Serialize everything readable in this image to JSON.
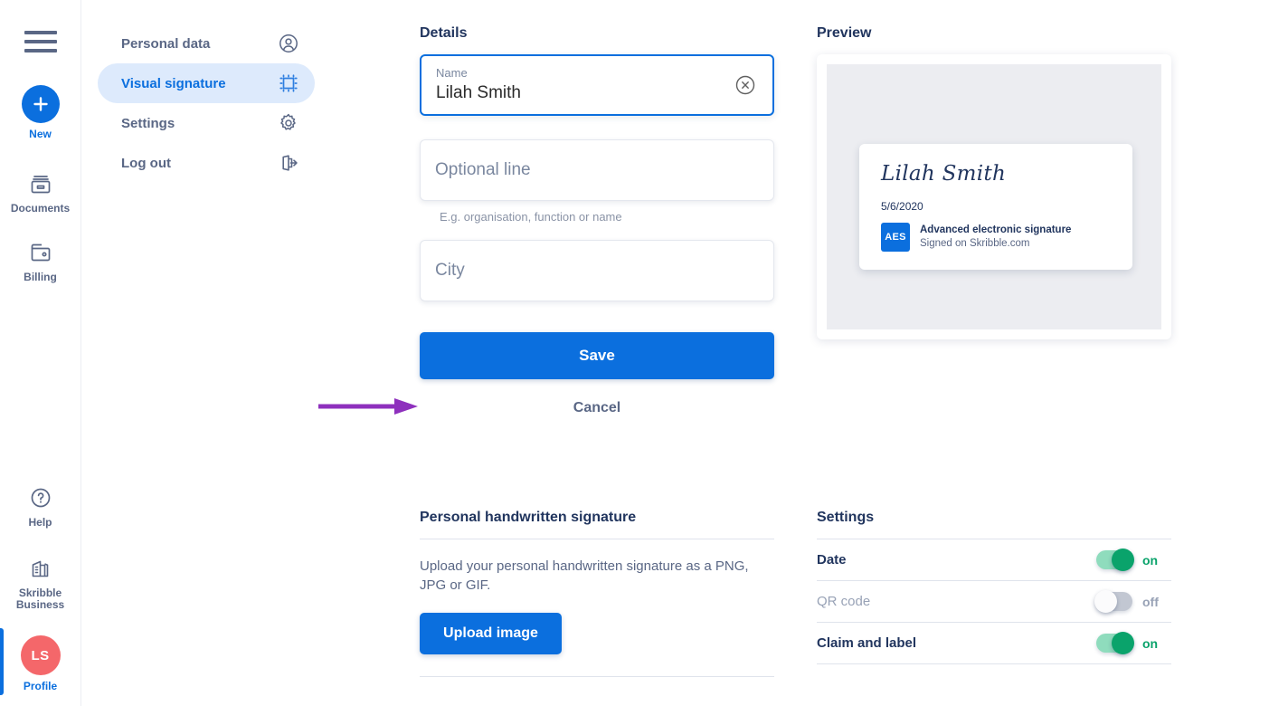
{
  "rail": {
    "menu_icon": "hamburger-icon",
    "items": [
      {
        "label": "New",
        "icon": "plus-icon",
        "active": false
      },
      {
        "label": "Documents",
        "icon": "documents-icon",
        "active": false
      },
      {
        "label": "Billing",
        "icon": "billing-icon",
        "active": false
      },
      {
        "label": "Help",
        "icon": "help-circle-icon",
        "active": false
      },
      {
        "label": "Skribble\nBusiness",
        "icon": "building-icon",
        "active": false
      },
      {
        "label": "Profile",
        "icon": "avatar-icon",
        "active": true
      }
    ],
    "help_label": "Help",
    "business_label_line1": "Skribble",
    "business_label_line2": "Business",
    "profile_label": "Profile",
    "new_label": "New",
    "documents_label": "Documents",
    "billing_label": "Billing",
    "avatar_initials": "LS"
  },
  "subnav": {
    "items": [
      {
        "label": "Personal data",
        "icon": "user-circle-icon",
        "active": false
      },
      {
        "label": "Visual signature",
        "icon": "crop-frame-icon",
        "active": true
      },
      {
        "label": "Settings",
        "icon": "gear-icon",
        "active": false
      },
      {
        "label": "Log out",
        "icon": "logout-icon",
        "active": false
      }
    ]
  },
  "details": {
    "title": "Details",
    "name_field": {
      "label": "Name",
      "value": "Lilah Smith",
      "clear_icon": "clear-circle-icon"
    },
    "optional_field": {
      "placeholder": "Optional line",
      "value": "",
      "hint": "E.g. organisation, function or name"
    },
    "city_field": {
      "placeholder": "City",
      "value": ""
    },
    "save_label": "Save",
    "cancel_label": "Cancel"
  },
  "annotation": {
    "arrow": "purple-arrow-pointing-to-save",
    "color": "#8e30bd"
  },
  "preview": {
    "title": "Preview",
    "signature": {
      "name": "Lilah Smith",
      "date": "5/6/2020",
      "badge": "AES",
      "claim": "Advanced electronic signature",
      "label": "Signed on Skribble.com"
    }
  },
  "handwritten": {
    "title": "Personal handwritten signature",
    "description": "Upload your personal handwritten signature as a PNG, JPG or GIF.",
    "upload_label": "Upload image"
  },
  "settings": {
    "title": "Settings",
    "rows": [
      {
        "name": "Date",
        "state": "on"
      },
      {
        "name": "QR code",
        "state": "off"
      },
      {
        "name": "Claim and label",
        "state": "on"
      }
    ]
  },
  "colors": {
    "brand_blue": "#0b6fde",
    "nav_slate": "#5a6785",
    "heading_navy": "#21355e",
    "toggle_green": "#0aa36b",
    "avatar_coral": "#f4676a",
    "annotation_purple": "#8e30bd",
    "preview_bg": "#ecedf1"
  }
}
